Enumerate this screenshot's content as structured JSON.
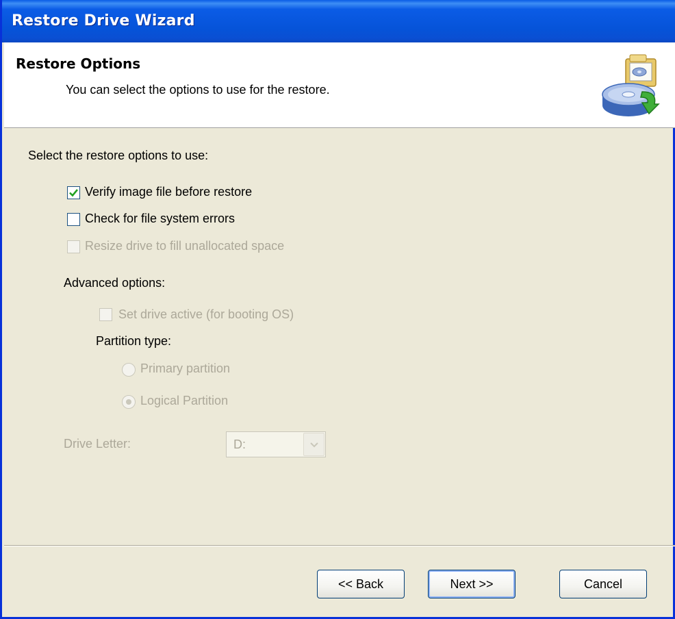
{
  "window": {
    "title": "Restore Drive Wizard"
  },
  "header": {
    "title": "Restore Options",
    "subtitle": "You can select the options to use for the restore.",
    "icon": "drive-restore-icon"
  },
  "main": {
    "prompt": "Select the restore options to use:",
    "options": [
      {
        "label": "Verify image file before restore",
        "checked": true,
        "enabled": true
      },
      {
        "label": "Check for file system errors",
        "checked": false,
        "enabled": true
      },
      {
        "label": "Resize drive to fill unallocated space",
        "checked": false,
        "enabled": false
      }
    ],
    "advanced": {
      "heading": "Advanced options:",
      "set_active": {
        "label": "Set drive active (for booting OS)",
        "checked": false,
        "enabled": false
      },
      "partition_type_label": "Partition type:",
      "partition_types": [
        {
          "label": "Primary partition",
          "selected": false,
          "enabled": false
        },
        {
          "label": "Logical Partition",
          "selected": true,
          "enabled": false
        }
      ]
    },
    "drive_letter": {
      "label": "Drive Letter:",
      "value": "D:",
      "enabled": false
    }
  },
  "footer": {
    "back_label": "<< Back",
    "next_label": "Next >>",
    "cancel_label": "Cancel"
  },
  "colors": {
    "title_bar": "#0a5ce6",
    "dialog_bg": "#ece9d8",
    "disabled_text": "#aca899",
    "check_green": "#21a121"
  }
}
